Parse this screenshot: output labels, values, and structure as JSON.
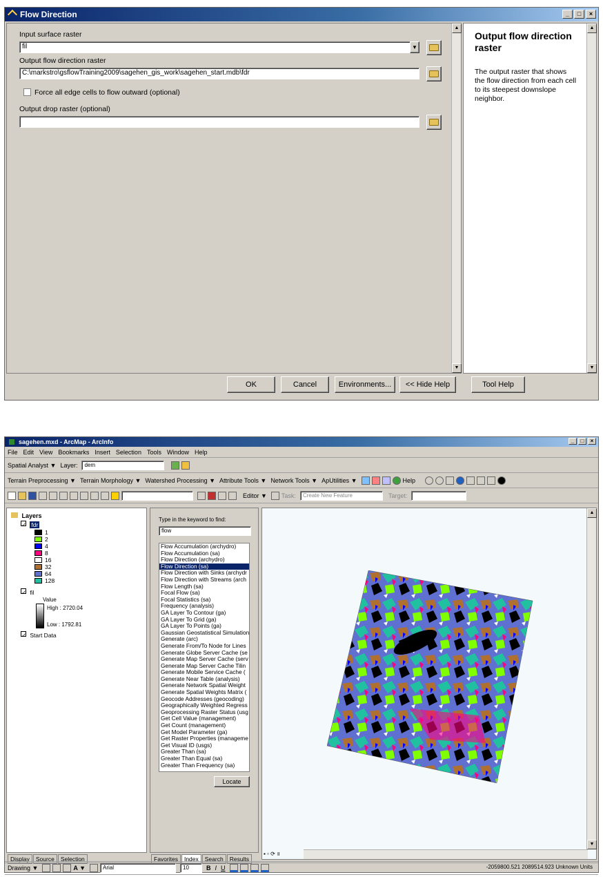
{
  "dialog": {
    "title": "Flow Direction",
    "input_surface_label": "Input surface raster",
    "input_surface_value": "fil",
    "output_flowdir_label": "Output flow direction raster",
    "output_flowdir_value": "C:\\markstro\\gsflowTraining2009\\sagehen_gis_work\\sagehen_start.mdb\\fdr",
    "force_edge_label": "Force all edge cells to flow outward (optional)",
    "force_edge_checked": false,
    "output_drop_label": "Output drop raster (optional)",
    "output_drop_value": "",
    "help_title": "Output flow direction raster",
    "help_text": "The output raster that shows the flow direction from each cell to its steepest downslope neighbor.",
    "buttons": {
      "ok": "OK",
      "cancel": "Cancel",
      "environments": "Environments...",
      "hide_help": "<< Hide Help",
      "tool_help": "Tool Help"
    }
  },
  "arcmap": {
    "title": "sagehen.mxd - ArcMap - ArcInfo",
    "menu": [
      "File",
      "Edit",
      "View",
      "Bookmarks",
      "Insert",
      "Selection",
      "Tools",
      "Window",
      "Help"
    ],
    "spatial_analyst_label": "Spatial Analyst ▼",
    "layer_label": "Layer:",
    "layer_value": "dem",
    "hydro_toolbar": [
      "Terrain Preprocessing ▼",
      "Terrain Morphology ▼",
      "Watershed Processing ▼",
      "Attribute Tools ▼",
      "Network Tools ▼",
      "ApUtilities ▼"
    ],
    "help_label": "Help",
    "editor_label": "Editor ▼",
    "task_label": "Task:",
    "task_value": "Create New Feature",
    "target_label": "Target:",
    "toc": {
      "root": "Layers",
      "layer_fdr": "fdr",
      "fdr_classes": [
        {
          "label": "1",
          "color": "#000000"
        },
        {
          "label": "2",
          "color": "#80ff00"
        },
        {
          "label": "4",
          "color": "#0000ff"
        },
        {
          "label": "8",
          "color": "#ff0080"
        },
        {
          "label": "16",
          "color": "#ffffff"
        },
        {
          "label": "32",
          "color": "#b07030"
        },
        {
          "label": "64",
          "color": "#6070d0"
        },
        {
          "label": "128",
          "color": "#20c0a0"
        }
      ],
      "layer_fil": "fil",
      "value_label": "Value",
      "high_label": "High : 2720.04",
      "low_label": "Low : 1792.81",
      "start_data": "Start Data",
      "tabs": [
        "Display",
        "Source",
        "Selection"
      ]
    },
    "search": {
      "prompt": "Type in the keyword to find:",
      "query": "flow",
      "results": [
        "Flow Accumulation (archydro)",
        "Flow Accumulation (sa)",
        "Flow Direction (archydro)",
        "Flow Direction (sa)",
        "Flow Direction with Sinks (archydr",
        "Flow Direction with Streams (arch",
        "Flow Length (sa)",
        "Focal Flow (sa)",
        "Focal Statistics (sa)",
        "Frequency (analysis)",
        "GA Layer To Contour (ga)",
        "GA Layer To Grid (ga)",
        "GA Layer To Points (ga)",
        "Gaussian Geostatistical Simulation",
        "Generate (arc)",
        "Generate From/To Node for Lines",
        "Generate Globe Server Cache (se",
        "Generate Map Server Cache (serv",
        "Generate Map Server Cache Tilin",
        "Generate Mobile Service Cache (",
        "Generate Near Table (analysis)",
        "Generate Network Spatial Weight",
        "Generate Spatial Weights Matrix (",
        "Geocode Addresses (geocoding)",
        "Geographically Weighted Regress",
        "Geoprocessing Raster Status (usg",
        "Get Cell Value (management)",
        "Get Count (management)",
        "Get Model Parameter (ga)",
        "Get Raster Properties (manageme",
        "Get Visual ID (usgs)",
        "Greater Than (sa)",
        "Greater Than Equal (sa)",
        "Greater Than Frequency (sa)"
      ],
      "selected_index": 3,
      "locate": "Locate",
      "tabs": [
        "Favorites",
        "Index",
        "Search",
        "Results"
      ]
    },
    "drawing_toolbar": {
      "drawing_label": "Drawing ▼",
      "font": "Arial",
      "size": "10"
    },
    "status_coords": "-2059800.521  2089514.923 Unknown Units"
  }
}
